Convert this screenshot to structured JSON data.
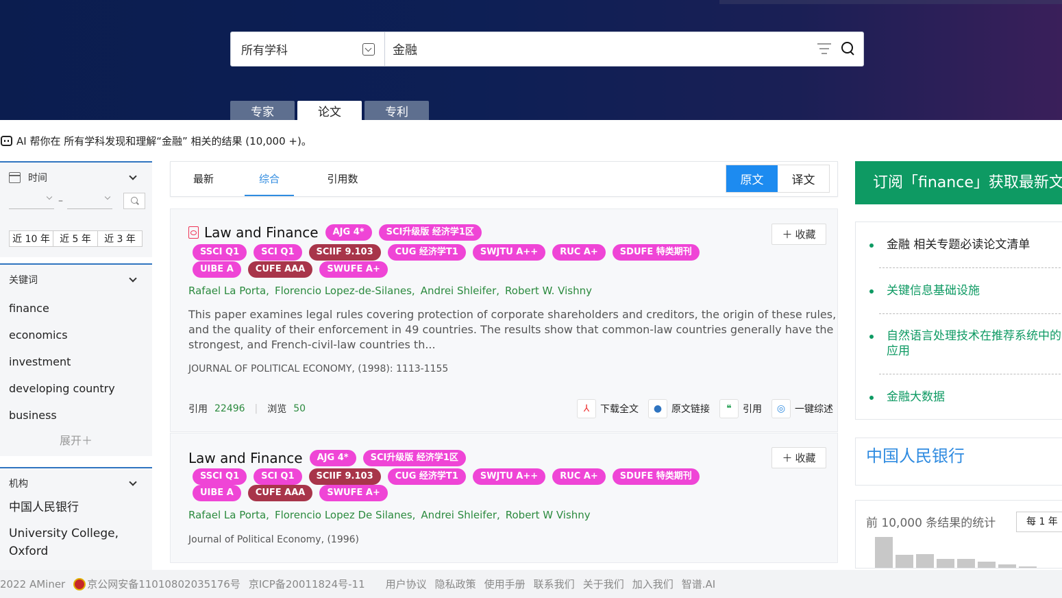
{
  "search": {
    "subject": "所有学科",
    "query": "金融"
  },
  "tabs": [
    "专家",
    "论文",
    "专利"
  ],
  "ai_line": "AI 帮你在 所有学科发现和理解“金融” 相关的结果 (10,000 +)。",
  "sidebar": {
    "time": {
      "title": "时间",
      "date_sep": "–",
      "ranges": [
        "近 10 年",
        "近 5 年",
        "近 3 年"
      ]
    },
    "keywords": {
      "title": "关键词",
      "items": [
        "finance",
        "economics",
        "investment",
        "developing country",
        "business"
      ],
      "expand": "展开＋"
    },
    "orgs": {
      "title": "机构",
      "items": [
        "中国人民银行",
        "University College, Oxford"
      ]
    }
  },
  "sort": {
    "tabs": [
      "最新",
      "综合",
      "引用数"
    ],
    "active": "综合",
    "lang": [
      "原文",
      "译文"
    ]
  },
  "papers": [
    {
      "title": "Law and Finance",
      "badges_row1": [
        "AJG 4*",
        "SCI升级版 经济学1区"
      ],
      "badges_row2": [
        "SSCI Q1",
        "SCI Q1",
        "SCIIF 9.103",
        "CUG 经济学T1",
        "SWJTU A++",
        "RUC A+",
        "SDUFE 特类期刊"
      ],
      "badges_row3": [
        "UIBE A",
        "CUFE AAA",
        "SWUFE A+"
      ],
      "collect": "收藏",
      "authors": [
        "Rafael La Porta,",
        "Florencio Lopez-de-Silanes,",
        "Andrei Shleifer,",
        "Robert W. Vishny"
      ],
      "abstract": "This paper examines legal rules covering protection of corporate shareholders and creditors, the origin of these rules, and the quality of their enforcement in 49 countries. The results show that common-law countries generally have the strongest, and French-civil-law countries th...",
      "venue": "JOURNAL OF POLITICAL ECONOMY, (1998): 1113-1155",
      "cite_label": "引用",
      "cite_count": "22496",
      "view_label": "浏览",
      "view_count": "50",
      "actions": [
        "下载全文",
        "原文链接",
        "引用",
        "一键综述"
      ]
    },
    {
      "title": "Law and Finance",
      "badges_row1": [
        "AJG 4*",
        "SCI升级版 经济学1区"
      ],
      "badges_row2": [
        "SSCI Q1",
        "SCI Q1",
        "SCIIF 9.103",
        "CUG 经济学T1",
        "SWJTU A++",
        "RUC A+",
        "SDUFE 特类期刊"
      ],
      "badges_row3": [
        "UIBE A",
        "CUFE AAA",
        "SWUFE A+"
      ],
      "collect": "收藏",
      "authors": [
        "Rafael La Porta,",
        "Florencio Lopez De Silanes,",
        "Andrei Shleifer,",
        "Robert W Vishny"
      ],
      "venue": "Journal of Political Economy, (1996)"
    }
  ],
  "right": {
    "subscribe": "订阅「finance」获取最新文",
    "topics": [
      "金融 相关专题必读论文清单",
      "关键信息基础设施",
      "自然语言处理技术在推荐系统中的应用",
      "金融大数据"
    ],
    "org": "中国人民银行",
    "stats_title": "前 10,000 条结果的统计",
    "stats_select": "每 1 年"
  },
  "footer": {
    "copyright": "2022 AMiner",
    "beian_police": "京公网安备11010802035176号",
    "icp": "京ICP备20011824号-11",
    "links": [
      "用户协议",
      "隐私政策",
      "使用手册",
      "联系我们",
      "关于我们",
      "加入我们",
      "智谱.AI"
    ]
  },
  "colors": {
    "header_bg": "#0b1d4f",
    "accent_blue": "#1d8bf0",
    "green": "#0e9a63",
    "badge_pink": "#ef45d6",
    "badge_dark": "#a8354a"
  }
}
